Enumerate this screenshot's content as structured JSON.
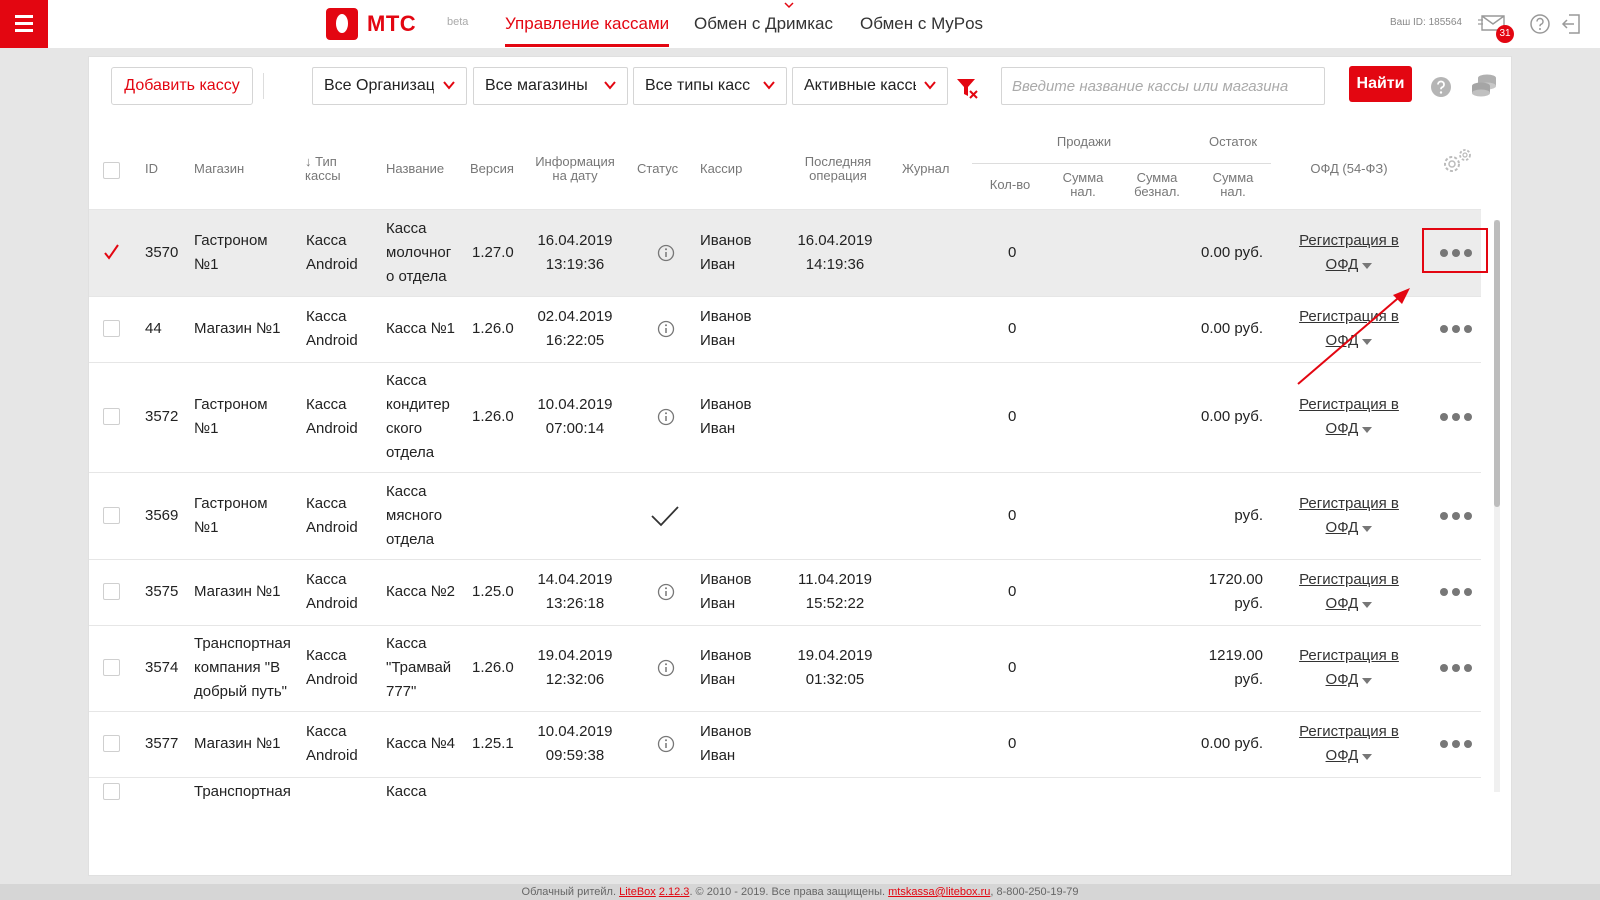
{
  "header": {
    "logo_text": "МТС",
    "beta_label": "beta",
    "tabs": [
      {
        "label": "Управление кассами",
        "active": true
      },
      {
        "label": "Обмен с Дримкас",
        "active": false
      },
      {
        "label": "Обмен с MyPos",
        "active": false
      }
    ],
    "user_id": "Ваш ID: 185564",
    "notifications_count": "31"
  },
  "toolbar": {
    "add_button": "Добавить кассу",
    "filters": [
      "Все Организации",
      "Все магазины",
      "Все типы касс",
      "Активные кассы"
    ],
    "search_placeholder": "Введите название кассы или магазина",
    "find_button": "Найти"
  },
  "table": {
    "headers": {
      "id": "ID",
      "shop": "Магазин",
      "type": "↓ Тип кассы",
      "name": "Название",
      "version": "Версия",
      "info": "Информация на дату",
      "status": "Статус",
      "cashier": "Кассир",
      "last_op": "Последняя операция",
      "journal": "Журнал",
      "sales_group": "Продажи",
      "balance_group": "Остаток",
      "count": "Кол-во",
      "sum_cash": "Сумма нал.",
      "sum_noncash": "Сумма безнал.",
      "balance_cash": "Сумма нал.",
      "ofd": "ОФД (54-ФЗ)"
    },
    "rows": [
      {
        "checked": true,
        "id": "3570",
        "shop": [
          "Гастроном",
          "№1"
        ],
        "type": [
          "Касса",
          "Android"
        ],
        "name": [
          "Касса",
          "молочног",
          "о отдела"
        ],
        "version": "1.27.0",
        "info": [
          "16.04.2019",
          "13:19:36"
        ],
        "status": "info",
        "cashier": [
          "Иванов",
          "Иван"
        ],
        "last_op": [
          "16.04.2019",
          "14:19:36"
        ],
        "count": "0",
        "balance": [
          "0.00 руб."
        ],
        "ofd": [
          "Регистрация в",
          "ОФД"
        ]
      },
      {
        "checked": false,
        "id": "44",
        "shop": [
          "Магазин №1"
        ],
        "type": [
          "Касса",
          "Android"
        ],
        "name": [
          "Касса №1"
        ],
        "version": "1.26.0",
        "info": [
          "02.04.2019",
          "16:22:05"
        ],
        "status": "info",
        "cashier": [
          "Иванов",
          "Иван"
        ],
        "last_op": [],
        "count": "0",
        "balance": [
          "0.00 руб."
        ],
        "ofd": [
          "Регистрация в",
          "ОФД"
        ]
      },
      {
        "checked": false,
        "id": "3572",
        "shop": [
          "Гастроном",
          "№1"
        ],
        "type": [
          "Касса",
          "Android"
        ],
        "name": [
          "Касса",
          "кондитер",
          "ского",
          "отдела"
        ],
        "version": "1.26.0",
        "info": [
          "10.04.2019",
          "07:00:14"
        ],
        "status": "info",
        "cashier": [
          "Иванов",
          "Иван"
        ],
        "last_op": [],
        "count": "0",
        "balance": [
          "0.00 руб."
        ],
        "ofd": [
          "Регистрация в",
          "ОФД"
        ]
      },
      {
        "checked": false,
        "id": "3569",
        "shop": [
          "Гастроном",
          "№1"
        ],
        "type": [
          "Касса",
          "Android"
        ],
        "name": [
          "Касса",
          "мясного",
          "отдела"
        ],
        "version": "",
        "info": [],
        "status": "check",
        "cashier": [],
        "last_op": [],
        "count": "0",
        "balance": [
          "руб."
        ],
        "ofd": [
          "Регистрация в",
          "ОФД"
        ]
      },
      {
        "checked": false,
        "id": "3575",
        "shop": [
          "Магазин №1"
        ],
        "type": [
          "Касса",
          "Android"
        ],
        "name": [
          "Касса №2"
        ],
        "version": "1.25.0",
        "info": [
          "14.04.2019",
          "13:26:18"
        ],
        "status": "info",
        "cashier": [
          "Иванов",
          "Иван"
        ],
        "last_op": [
          "11.04.2019",
          "15:52:22"
        ],
        "count": "0",
        "balance": [
          "1720.00",
          "руб."
        ],
        "ofd": [
          "Регистрация в",
          "ОФД"
        ]
      },
      {
        "checked": false,
        "id": "3574",
        "shop": [
          "Транспортная",
          "компания \"В",
          "добрый путь\""
        ],
        "type": [
          "Касса",
          "Android"
        ],
        "name": [
          "Касса",
          "\"Трамвай",
          "777\""
        ],
        "version": "1.26.0",
        "info": [
          "19.04.2019",
          "12:32:06"
        ],
        "status": "info",
        "cashier": [
          "Иванов",
          "Иван"
        ],
        "last_op": [
          "19.04.2019",
          "01:32:05"
        ],
        "count": "0",
        "balance": [
          "1219.00",
          "руб."
        ],
        "ofd": [
          "Регистрация в",
          "ОФД"
        ]
      },
      {
        "checked": false,
        "id": "3577",
        "shop": [
          "Магазин №1"
        ],
        "type": [
          "Касса",
          "Android"
        ],
        "name": [
          "Касса №4"
        ],
        "version": "1.25.1",
        "info": [
          "10.04.2019",
          "09:59:38"
        ],
        "status": "info",
        "cashier": [
          "Иванов",
          "Иван"
        ],
        "last_op": [],
        "count": "0",
        "balance": [
          "0.00 руб."
        ],
        "ofd": [
          "Регистрация в",
          "ОФД"
        ]
      },
      {
        "checked": false,
        "id": "",
        "shop": [
          "Транспортная"
        ],
        "type": [],
        "name": [
          "Касса"
        ],
        "version": "",
        "info": [],
        "status": "",
        "cashier": [],
        "last_op": [],
        "count": "",
        "balance": [],
        "ofd": []
      }
    ]
  },
  "footer": {
    "prefix": "Облачный ритейл.",
    "link_brand": "LiteBox",
    "link_version": "2.12.3",
    "copyright": ". © 2010 - 2019. Все права защищены.",
    "email": "mtskassa@litebox.ru",
    "phone": ", 8-800-250-19-79"
  },
  "colors": {
    "brand": "#e30611",
    "text": "#222222",
    "muted": "#777777"
  }
}
